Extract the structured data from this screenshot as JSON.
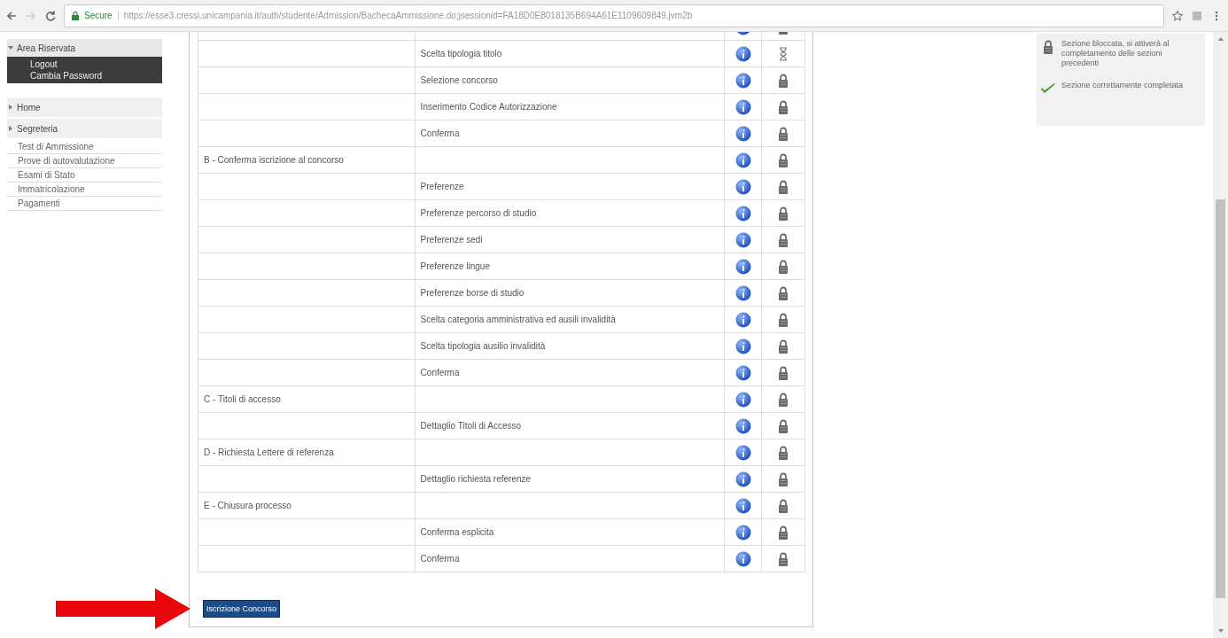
{
  "browser": {
    "secure_label": "Secure",
    "url": "https://esse3.cressi.unicampania.it/auth/studente/Admission/BachecaAmmissione.do;jsessionid=FA18D0E8018135B694A61E1109609849.jvm2b"
  },
  "sidebar": {
    "reserved_area": {
      "title": "Area Riservata",
      "items": [
        "Logout",
        "Cambia Password"
      ]
    },
    "menu": [
      {
        "label": "Home"
      },
      {
        "label": "Segreteria",
        "children": [
          "Test di Ammissione",
          "Prove di autovalutazione",
          "Esami di Stato",
          "Immatricolazione",
          "Pagamenti"
        ]
      }
    ]
  },
  "table": {
    "rows": [
      {
        "kind": "locked"
      },
      {
        "substep": "Scelta tipologia titolo",
        "kind": "pending"
      },
      {
        "substep": "Selezione concorso",
        "kind": "locked"
      },
      {
        "substep": "Inserimento Codice Autorizzazione",
        "kind": "locked"
      },
      {
        "substep": "Conferma",
        "kind": "locked"
      },
      {
        "step": "B - Conferma iscrizione al concorso",
        "kind": "locked"
      },
      {
        "substep": "Preferenze",
        "kind": "locked"
      },
      {
        "substep": "Preferenze percorso di studio",
        "kind": "locked"
      },
      {
        "substep": "Preferenze sedi",
        "kind": "locked"
      },
      {
        "substep": "Preferenze lingue",
        "kind": "locked"
      },
      {
        "substep": "Preferenze borse di studio",
        "kind": "locked"
      },
      {
        "substep": "Scelta categoria amministrativa ed ausili invalidità",
        "kind": "locked"
      },
      {
        "substep": "Scelta tipologia ausilio invalidità",
        "kind": "locked"
      },
      {
        "substep": "Conferma",
        "kind": "locked"
      },
      {
        "step": "C - Titoli di accesso",
        "kind": "locked"
      },
      {
        "substep": "Dettaglio Titoli di Accesso",
        "kind": "locked"
      },
      {
        "step": "D - Richiesta Lettere di referenza",
        "kind": "locked"
      },
      {
        "substep": "Dettaglio richiesta referenze",
        "kind": "locked"
      },
      {
        "step": "E - Chiusura processo",
        "kind": "locked"
      },
      {
        "substep": "Conferma esplicita",
        "kind": "locked"
      },
      {
        "substep": "Conferma",
        "kind": "locked"
      }
    ]
  },
  "submit_button": "Iscrizione Concorso",
  "legend": [
    {
      "kind": "locked",
      "text": "Sezione bloccata, si attiverà al completamento delle sezioni precedenti"
    },
    {
      "kind": "done",
      "text": "Sezione correttamente completata"
    }
  ]
}
